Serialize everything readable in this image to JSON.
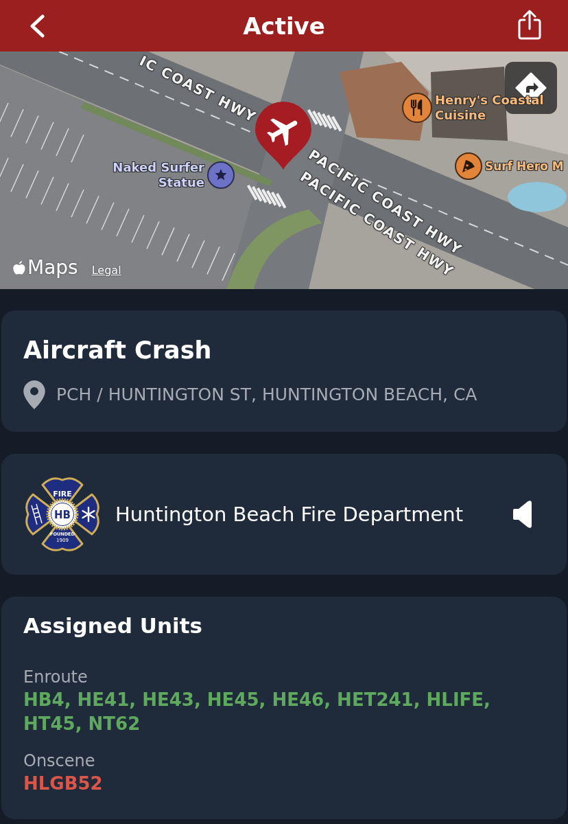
{
  "header": {
    "title": "Active"
  },
  "map": {
    "roads": [
      "IC COAST HWY",
      "PACIFIC COAST HWY",
      "PACIFIC COAST HWY"
    ],
    "places": [
      {
        "name": "Naked Surfer Statue",
        "kind": "landmark"
      },
      {
        "name": "Henry's Coastal Cuisine",
        "kind": "restaurant"
      },
      {
        "name": "Surf Hero M",
        "kind": "pizza"
      }
    ],
    "attribution": {
      "logo": "Maps",
      "link": "Legal"
    }
  },
  "incident": {
    "type": "Aircraft Crash",
    "address": "PCH / HUNTINGTON ST, HUNTINGTON BEACH, CA"
  },
  "agency": {
    "name": "Huntington Beach Fire Department",
    "logo": {
      "top": "FIRE",
      "monogram": "HB",
      "founded": "FOUNDED",
      "year": "1909"
    }
  },
  "units": {
    "title": "Assigned Units",
    "groups": [
      {
        "status": "Enroute",
        "units": "HB4, HE41, HE43, HE45, HE46, HET241, HLIFE, HT45, NT62",
        "color": "#5fa95f"
      },
      {
        "status": "Onscene",
        "units": "HLGB52",
        "color": "#d9564a"
      }
    ]
  }
}
